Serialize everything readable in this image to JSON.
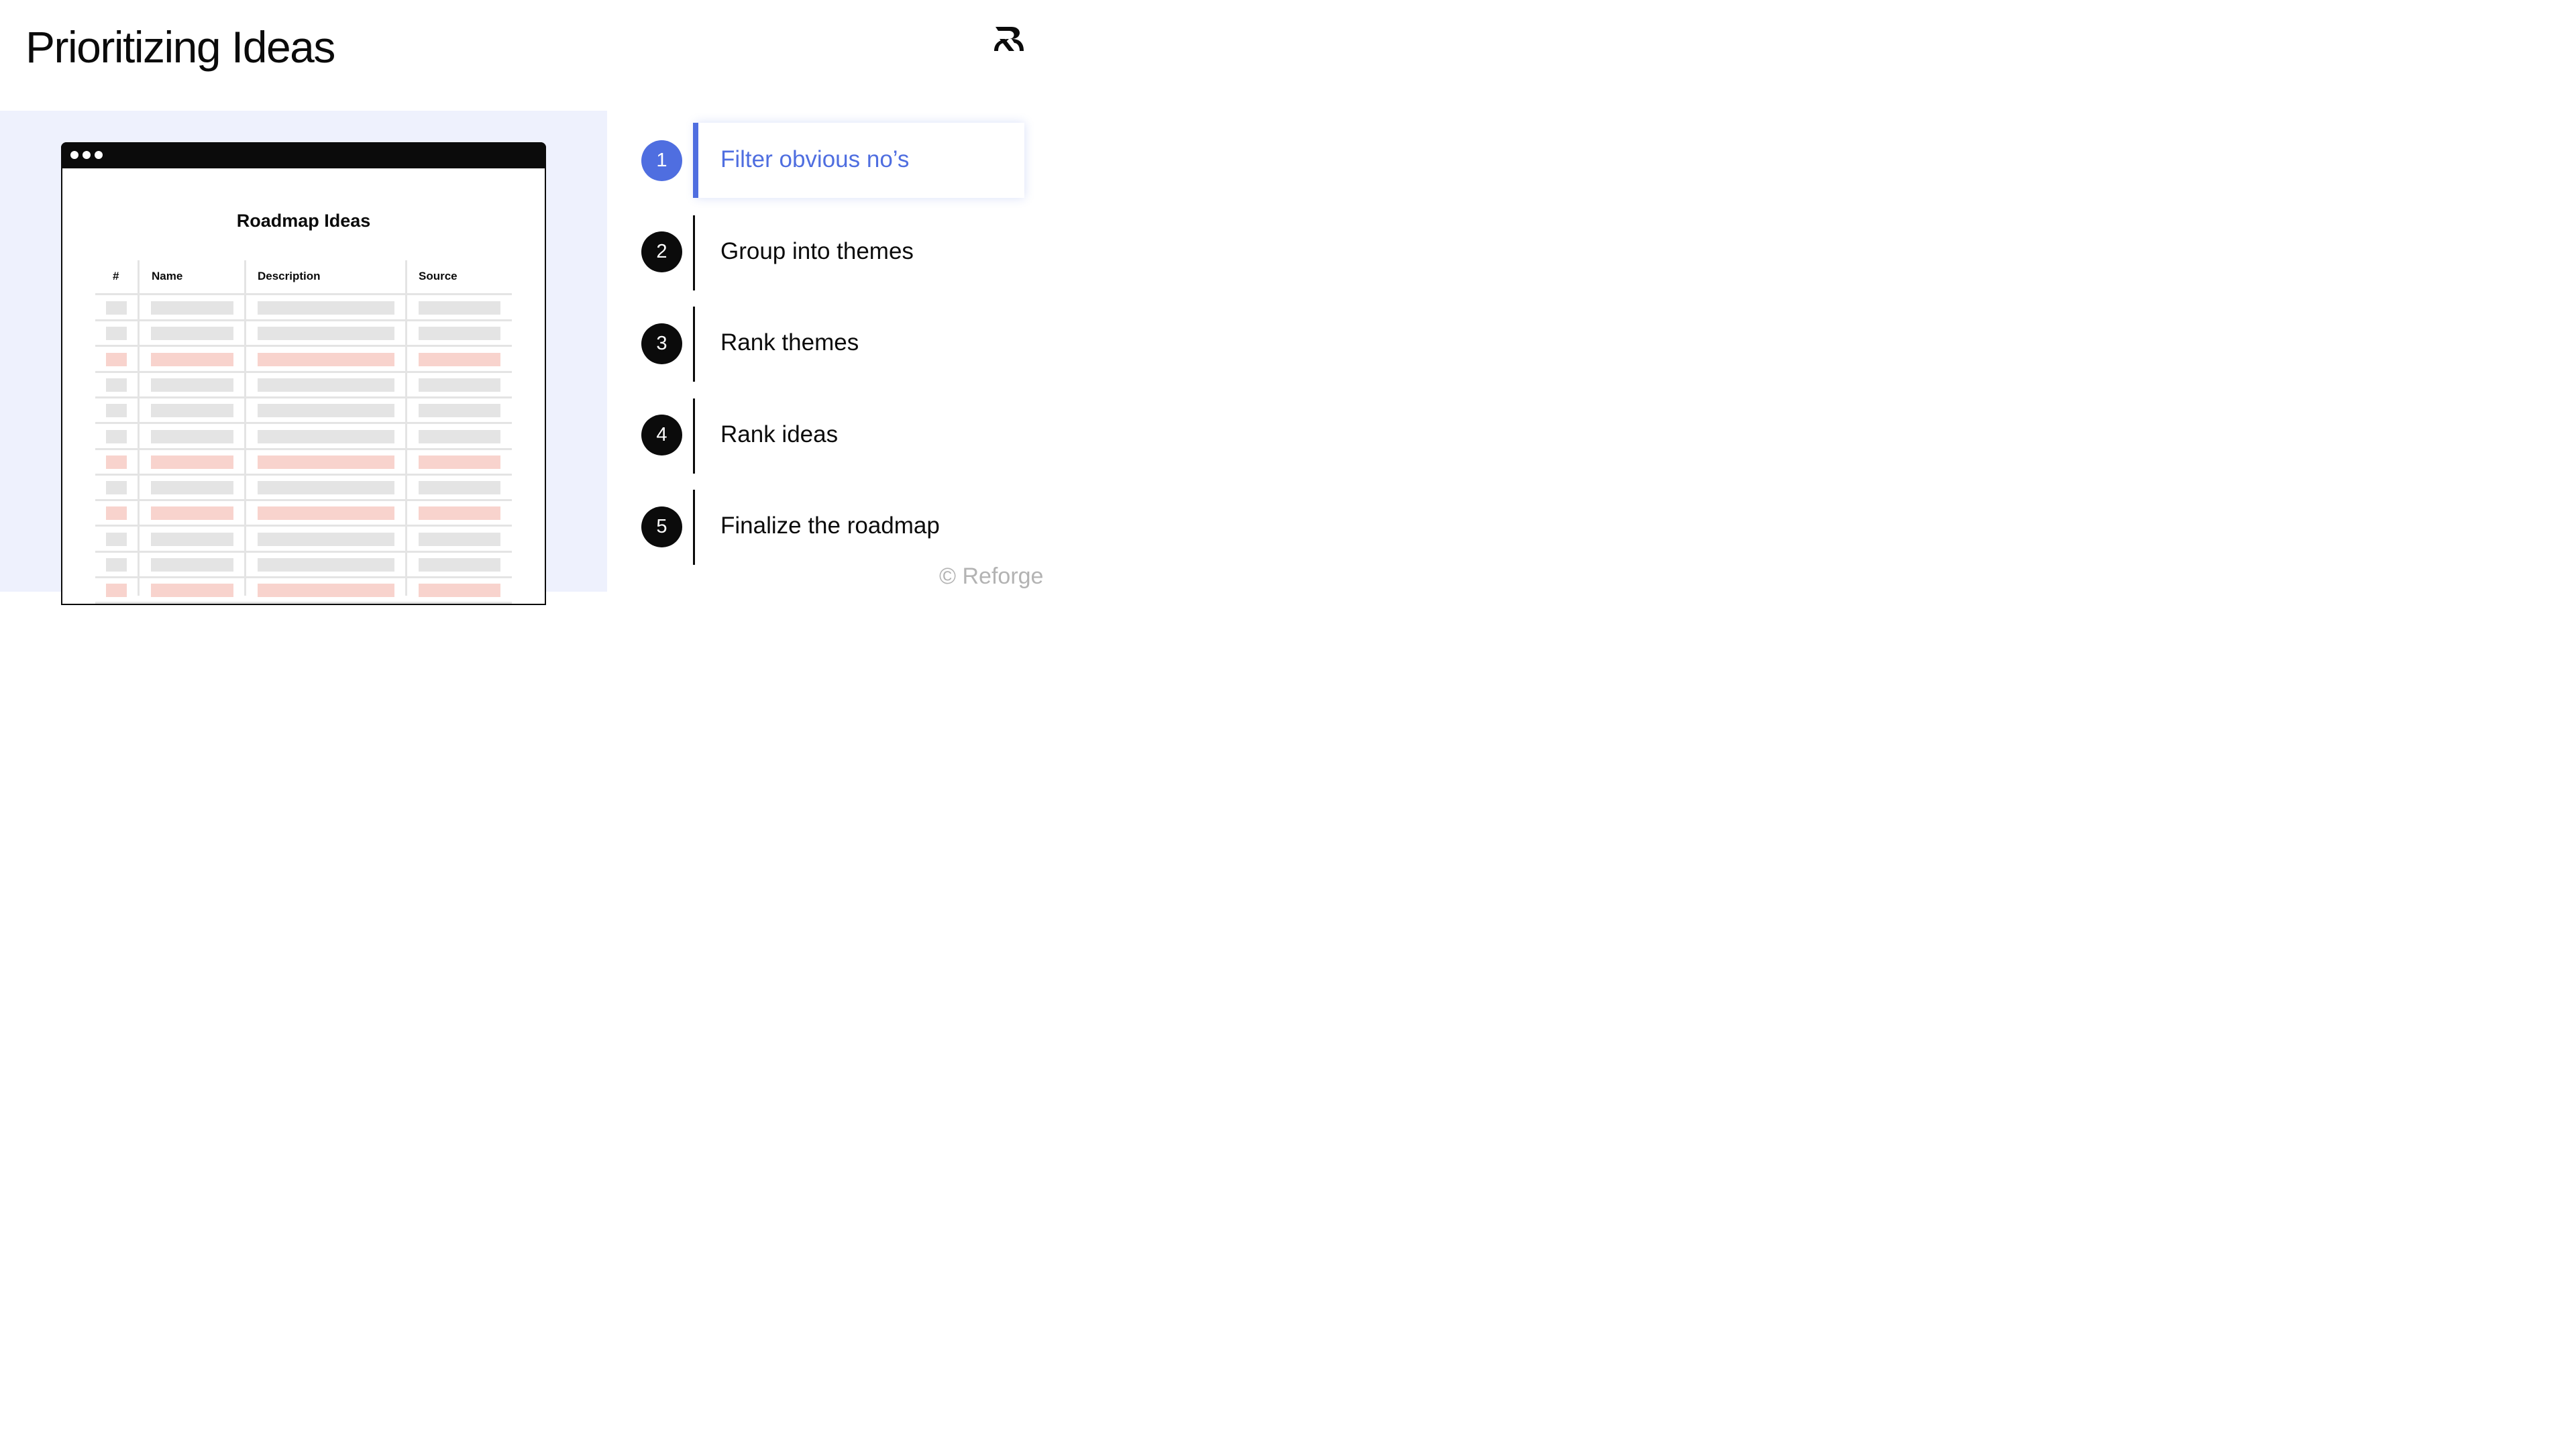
{
  "slide": {
    "title": "Prioritizing Ideas",
    "logo_icon": "reforge-logo-icon",
    "copyright": "© Reforge"
  },
  "mockup": {
    "document_title": "Roadmap Ideas",
    "columns": [
      "#",
      "Name",
      "Description",
      "Source"
    ],
    "rows": [
      {
        "highlight": false
      },
      {
        "highlight": false
      },
      {
        "highlight": true
      },
      {
        "highlight": false
      },
      {
        "highlight": false
      },
      {
        "highlight": false
      },
      {
        "highlight": true
      },
      {
        "highlight": false
      },
      {
        "highlight": true
      },
      {
        "highlight": false
      },
      {
        "highlight": false
      },
      {
        "highlight": true
      }
    ],
    "colors": {
      "neutral_row": "#e4e4e4",
      "highlight_row": "#f8d3cd",
      "panel_bg": "#eef1fd"
    }
  },
  "steps": [
    {
      "number": "1",
      "label": "Filter obvious no’s",
      "active": true
    },
    {
      "number": "2",
      "label": "Group into themes",
      "active": false
    },
    {
      "number": "3",
      "label": "Rank themes",
      "active": false
    },
    {
      "number": "4",
      "label": "Rank ideas",
      "active": false
    },
    {
      "number": "5",
      "label": "Finalize the roadmap",
      "active": false
    }
  ],
  "colors": {
    "accent": "#4f6ee0",
    "text": "#0b0b0b",
    "muted": "#b3b3b3"
  }
}
